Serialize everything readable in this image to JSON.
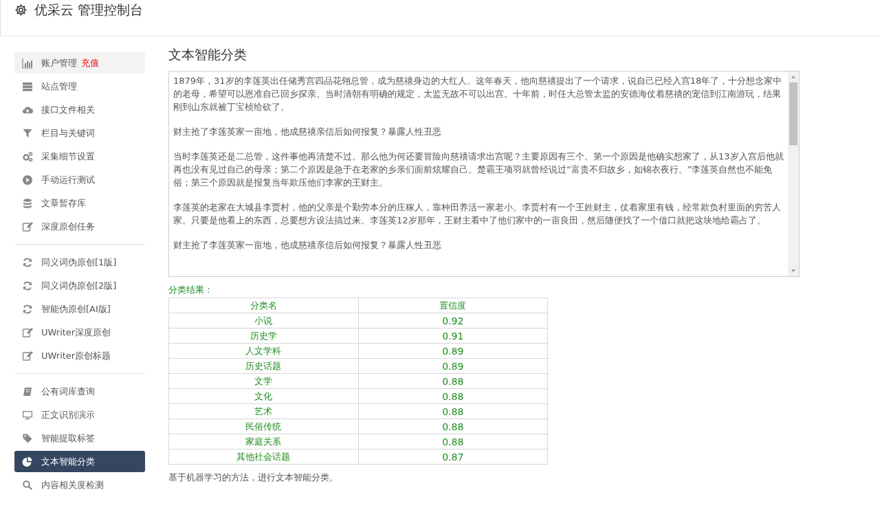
{
  "header": {
    "title": "优采云 管理控制台"
  },
  "sidebar": {
    "groups": [
      {
        "items": [
          {
            "label": "账户管理",
            "badge": "充值",
            "hovered": true,
            "selected": false
          },
          {
            "label": "站点管理",
            "hovered": false,
            "selected": false
          },
          {
            "label": "接口文件相关",
            "hovered": false,
            "selected": false
          },
          {
            "label": "栏目与关键词",
            "hovered": false,
            "selected": false
          },
          {
            "label": "采集细节设置",
            "hovered": false,
            "selected": false
          },
          {
            "label": "手动运行测试",
            "hovered": false,
            "selected": false
          },
          {
            "label": "文章暂存库",
            "hovered": false,
            "selected": false
          },
          {
            "label": "深度原创任务",
            "hovered": false,
            "selected": false
          }
        ]
      },
      {
        "items": [
          {
            "label": "同义词伪原创[1版]",
            "hovered": false,
            "selected": false
          },
          {
            "label": "同义词伪原创[2版]",
            "hovered": false,
            "selected": false
          },
          {
            "label": "智能伪原创[AI版]",
            "hovered": false,
            "selected": false
          },
          {
            "label": "UWriter深度原创",
            "hovered": false,
            "selected": false
          },
          {
            "label": "UWriter原创标题",
            "hovered": false,
            "selected": false
          }
        ]
      },
      {
        "items": [
          {
            "label": "公有词库查询",
            "hovered": false,
            "selected": false
          },
          {
            "label": "正文识别演示",
            "hovered": false,
            "selected": false
          },
          {
            "label": "智能提取标签",
            "hovered": false,
            "selected": false
          },
          {
            "label": "文本智能分类",
            "hovered": false,
            "selected": true
          },
          {
            "label": "内容相关度检测",
            "hovered": false,
            "selected": false
          }
        ]
      }
    ]
  },
  "main": {
    "title": "文本智能分类",
    "text_area": {
      "paragraphs": [
        "1879年，31岁的李莲英出任储秀宫四品花翎总管，成为慈禧身边的大红人。这年春天，他向慈禧提出了一个请求，说自己已经入宫18年了，十分想念家中的老母，希望可以恩准自己回乡探亲。当时清朝有明确的规定，太监无故不可以出宫。十年前，时任大总管太监的安德海仗着慈禧的宠信到江南游玩，结果刚到山东就被丁宝桢给砍了。",
        "财主抢了李莲英家一亩地，他成慈禧亲信后如何报复？暴露人性丑恶",
        "当时李莲英还是二总管，这件事他再清楚不过。那么他为何还要冒险向慈禧请求出宫呢？主要原因有三个。第一个原因是他确实想家了，从13岁入宫后他就再也没有见过自己的母亲；第二个原因是急于在老家的乡亲们面前炫耀自己。楚霸王项羽就曾经说过“富贵不归故乡，如锦衣夜行。”李莲英自然也不能免俗；第三个原因就是报复当年欺压他们李家的王财主。",
        "李莲英的老家在大城县李贾村，他的父亲是个勤劳本分的庄稼人，靠种田养活一家老小。李贾村有一个王姓财主，仗着家里有钱，经常欺负村里面的穷苦人家。只要是他看上的东西，总要想方设法搞过来。李莲英12岁那年，王财主看中了他们家中的一亩良田，然后随便找了一个借口就把这块地给霸占了。",
        "财主抢了李莲英家一亩地，他成慈禧亲信后如何报复？暴露人性丑恶"
      ]
    },
    "result_label": "分类结果：",
    "table": {
      "columns": [
        "分类名",
        "置信度"
      ],
      "rows": [
        [
          "小说",
          "0.92"
        ],
        [
          "历史学",
          "0.91"
        ],
        [
          "人文学科",
          "0.89"
        ],
        [
          "历史话题",
          "0.89"
        ],
        [
          "文学",
          "0.88"
        ],
        [
          "文化",
          "0.88"
        ],
        [
          "艺术",
          "0.88"
        ],
        [
          "民俗传统",
          "0.88"
        ],
        [
          "家庭关系",
          "0.88"
        ],
        [
          "其他社会话题",
          "0.87"
        ]
      ]
    },
    "footer_note": "基于机器学习的方法，进行文本智能分类。"
  }
}
